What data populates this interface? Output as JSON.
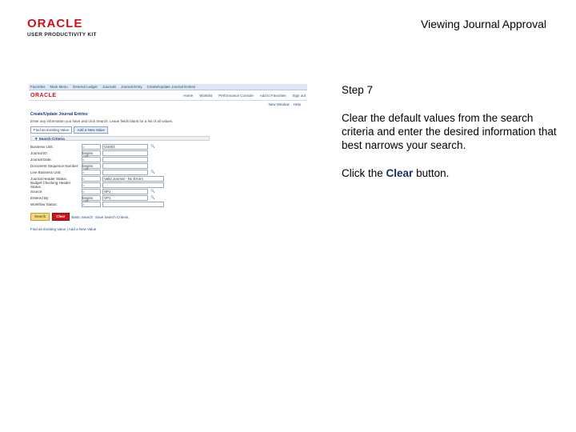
{
  "header": {
    "logo_oracle": "ORACLE",
    "logo_product": "USER PRODUCTIVITY KIT",
    "title": "Viewing Journal Approval"
  },
  "thumbnail": {
    "nav_items": [
      "Favorites",
      "Main Menu",
      "General Ledger",
      "Journals",
      "Journal Entry",
      "Create/Update Journal Entries"
    ],
    "brand": "ORACLE",
    "top_links": [
      "Home",
      "Worklist",
      "Performance Console",
      "Add to Favorites",
      "Sign out"
    ],
    "sub_links": [
      "New Window",
      "Help"
    ],
    "heading": "Create/Update Journal Entries",
    "description": "Enter any information you have and click Search. Leave fields blank for a list of all values.",
    "tabs": [
      "Find an Existing Value",
      "Add a New Value"
    ],
    "criteria_label": "Search Criteria",
    "rows": [
      {
        "label": "Business Unit:",
        "op": "=",
        "value": "US001"
      },
      {
        "label": "Journal ID:",
        "op": "begins with",
        "value": ""
      },
      {
        "label": "Journal Date:",
        "op": "=",
        "value": ""
      },
      {
        "label": "Document Sequence Number:",
        "op": "begins with",
        "value": ""
      },
      {
        "label": "Line Business Unit:",
        "op": "=",
        "value": ""
      },
      {
        "label": "Journal Header Status:",
        "op": "=",
        "value": "Valid Journal - No Errors"
      },
      {
        "label": "Budget Checking Header Status:",
        "op": "=",
        "value": ""
      },
      {
        "label": "Source:",
        "op": "=",
        "value": "SPJ"
      },
      {
        "label": "Entered By:",
        "op": "begins with",
        "value": "VP1"
      },
      {
        "label": "Workflow Status:",
        "op": "=",
        "value": ""
      }
    ],
    "buttons": {
      "search": "Search",
      "clear": "Clear",
      "basic": "Basic Search",
      "save": "Save Search Criteria"
    },
    "footer": "Find an Existing Value | Add a New Value"
  },
  "instructions": {
    "step": "Step 7",
    "body": "Clear the default values from the search criteria and enter the  desired information that best narrows your search.",
    "action_prefix": "Click the ",
    "action_target": "Clear",
    "action_suffix": " button."
  }
}
